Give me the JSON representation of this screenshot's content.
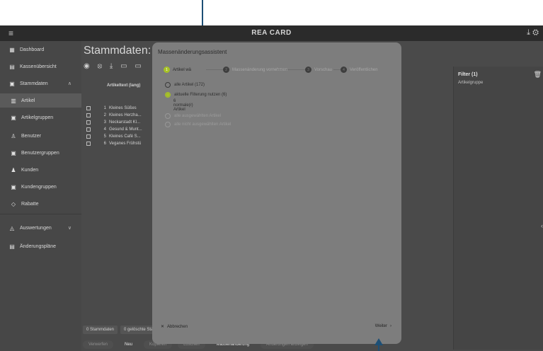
{
  "topbar": {
    "menu_icon": "menu-icon",
    "brand": "REA CARD",
    "right_icons": "⤓ ⚙"
  },
  "sidebar": {
    "items": [
      {
        "label": "Dashboard",
        "icon": "grid-icon",
        "glyph": "▦"
      },
      {
        "label": "Kassenübersicht",
        "icon": "register-icon",
        "glyph": "▤"
      },
      {
        "label": "Stammdaten",
        "icon": "folder-icon",
        "glyph": "▣",
        "chevron": "∧"
      },
      {
        "label": "Artikel",
        "icon": "article-icon",
        "glyph": "▥"
      },
      {
        "label": "Artikelgruppen",
        "icon": "group-icon",
        "glyph": "▣"
      },
      {
        "label": "Benutzer",
        "icon": "user-icon",
        "glyph": "♙"
      },
      {
        "label": "Benutzergruppen",
        "icon": "user-group-icon",
        "glyph": "▣"
      },
      {
        "label": "Kunden",
        "icon": "customers-icon",
        "glyph": "♟"
      },
      {
        "label": "Kundengruppen",
        "icon": "customer-group-icon",
        "glyph": "▣"
      },
      {
        "label": "Rabatte",
        "icon": "tag-icon",
        "glyph": "◇"
      },
      {
        "label": "Auswertungen",
        "icon": "chart-icon",
        "glyph": "◬",
        "chevron": "∨"
      },
      {
        "label": "Änderungspläne",
        "icon": "plan-icon",
        "glyph": "▤"
      }
    ]
  },
  "main": {
    "title": "Stammdaten: Arti",
    "toolbar_icons": "◉ ⦻ ⤓ ▭ ▭",
    "column_header": "Artikeltext (lang)",
    "rows": [
      {
        "num": "1",
        "text": "Kleines Süßes"
      },
      {
        "num": "2",
        "text": "Kleines Herzha..."
      },
      {
        "num": "3",
        "text": "Neckarstadt Kl..."
      },
      {
        "num": "4",
        "text": "Gesund & Munt..."
      },
      {
        "num": "5",
        "text": "Kleines Café S..."
      },
      {
        "num": "6",
        "text": "Veganes Frühstü"
      }
    ],
    "bottom_tabs": [
      "0 Stammdaten",
      "0 gelöschte Sta"
    ],
    "bottom_actions": [
      "Verwerfen",
      "Neu",
      "Kopieren",
      "Löschen",
      "Massenänderung",
      "Änderungen anzeigen"
    ]
  },
  "filter": {
    "title": "Filter (1)",
    "subtitle": "Artikelgruppe",
    "trash_icon": "trash-icon",
    "collapse": "‹"
  },
  "modal": {
    "title": "Massenänderungsassistent",
    "steps": [
      {
        "num": "1",
        "label": "Artikel wä"
      },
      {
        "num": "2",
        "label": "Massenänderung vornehmen"
      },
      {
        "num": "3",
        "label": "Vorschau"
      },
      {
        "num": "4",
        "label": "Veröffentlichen"
      }
    ],
    "options": [
      {
        "label": "alle Artikel (172)"
      },
      {
        "label": "aktuelle Filterung nutzen (6)",
        "sub": "6 normale(r) Artikel"
      },
      {
        "label": "alle ausgewählten Artikel"
      },
      {
        "label": "alle nicht ausgewählten Artikel"
      }
    ],
    "cancel_label": "Abbrechen",
    "next_label": "Weiter"
  }
}
